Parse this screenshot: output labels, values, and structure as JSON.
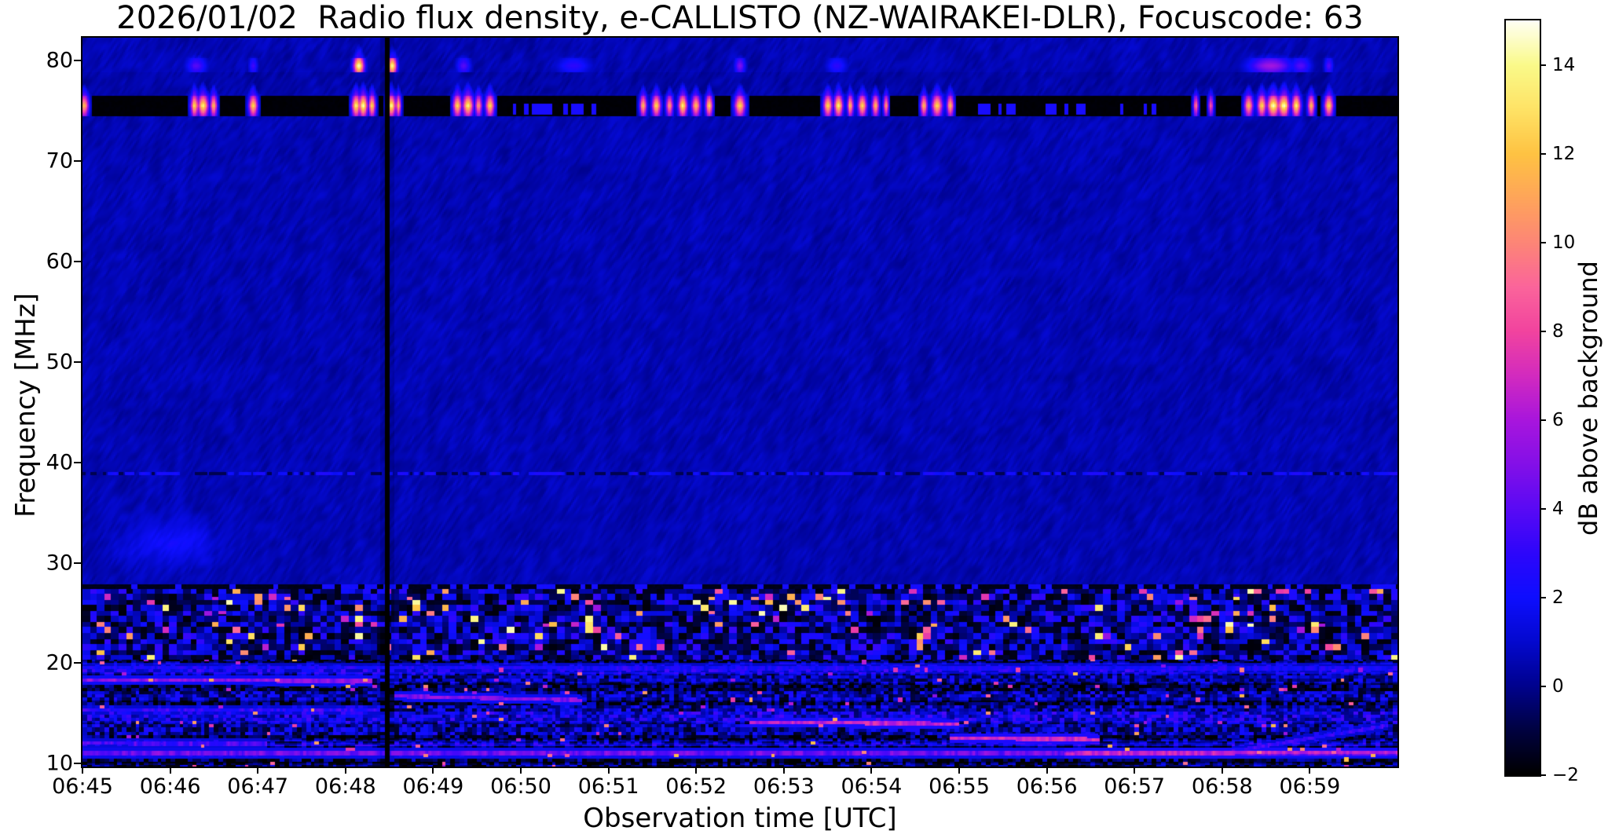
{
  "chart_data": {
    "type": "heatmap",
    "title": "2026/01/02  Radio flux density, e-CALLISTO (NZ-WAIRAKEI-DLR), Focuscode: 63",
    "xlabel": "Observation time [UTC]",
    "ylabel": "Frequency [MHz]",
    "colorbar_label": "dB above background",
    "x_axis": {
      "start_label": "06:45",
      "range_minutes": [
        0,
        15.0
      ],
      "ticks": [
        {
          "minute": 0,
          "label": "06:45"
        },
        {
          "minute": 1,
          "label": "06:46"
        },
        {
          "minute": 2,
          "label": "06:47"
        },
        {
          "minute": 3,
          "label": "06:48"
        },
        {
          "minute": 4,
          "label": "06:49"
        },
        {
          "minute": 5,
          "label": "06:50"
        },
        {
          "minute": 6,
          "label": "06:51"
        },
        {
          "minute": 7,
          "label": "06:52"
        },
        {
          "minute": 8,
          "label": "06:53"
        },
        {
          "minute": 9,
          "label": "06:54"
        },
        {
          "minute": 10,
          "label": "06:55"
        },
        {
          "minute": 11,
          "label": "06:56"
        },
        {
          "minute": 12,
          "label": "06:57"
        },
        {
          "minute": 13,
          "label": "06:58"
        },
        {
          "minute": 14,
          "label": "06:59"
        }
      ]
    },
    "y_axis": {
      "range_mhz": [
        9.7,
        82.3
      ],
      "ticks": [
        {
          "value": 80,
          "label": "80"
        },
        {
          "value": 70,
          "label": "70"
        },
        {
          "value": 60,
          "label": "60"
        },
        {
          "value": 50,
          "label": "50"
        },
        {
          "value": 40,
          "label": "40"
        },
        {
          "value": 30,
          "label": "30"
        },
        {
          "value": 20,
          "label": "20"
        },
        {
          "value": 10,
          "label": "10"
        }
      ]
    },
    "colorbar": {
      "range_db": [
        -2,
        15
      ],
      "ticks": [
        {
          "value": 14,
          "label": "14"
        },
        {
          "value": 12,
          "label": "12"
        },
        {
          "value": 10,
          "label": "10"
        },
        {
          "value": 8,
          "label": "8"
        },
        {
          "value": 6,
          "label": "6"
        },
        {
          "value": 4,
          "label": "4"
        },
        {
          "value": 2,
          "label": "2"
        },
        {
          "value": 0,
          "label": "0"
        },
        {
          "value": -2,
          "label": "−2"
        }
      ],
      "colormap_stops": [
        [
          -2,
          "#000000"
        ],
        [
          -1,
          "#000240"
        ],
        [
          0,
          "#00028e"
        ],
        [
          1,
          "#0409cf"
        ],
        [
          2,
          "#0e0eff"
        ],
        [
          3,
          "#2e06fb"
        ],
        [
          4,
          "#5a0af5"
        ],
        [
          5,
          "#8410e8"
        ],
        [
          6,
          "#a916dd"
        ],
        [
          7,
          "#d32bbf"
        ],
        [
          8,
          "#f2449f"
        ],
        [
          9,
          "#fb659b"
        ],
        [
          10,
          "#fd8677"
        ],
        [
          11,
          "#ffa55a"
        ],
        [
          12,
          "#fec343"
        ],
        [
          13,
          "#ffe366"
        ],
        [
          14,
          "#fafa8a"
        ],
        [
          15,
          "#fffff4"
        ]
      ]
    },
    "spectrogram": {
      "background_db": 0.55,
      "rfi_band_76": {
        "f_lo": 74.55,
        "f_hi": 76.6,
        "base_db": -1.9,
        "center_mhz": 75.55,
        "bursts_t_w_db": [
          [
            0.02,
            0.05,
            12
          ],
          [
            1.28,
            0.05,
            13
          ],
          [
            1.38,
            0.06,
            14
          ],
          [
            1.5,
            0.04,
            12
          ],
          [
            1.95,
            0.05,
            13
          ],
          [
            3.12,
            0.05,
            14
          ],
          [
            3.2,
            0.05,
            15
          ],
          [
            3.3,
            0.04,
            13
          ],
          [
            3.52,
            0.05,
            15
          ],
          [
            3.6,
            0.03,
            12
          ],
          [
            4.28,
            0.05,
            13
          ],
          [
            4.4,
            0.06,
            14
          ],
          [
            4.52,
            0.04,
            11
          ],
          [
            4.65,
            0.05,
            13
          ],
          [
            6.4,
            0.04,
            12
          ],
          [
            6.55,
            0.05,
            13
          ],
          [
            6.7,
            0.04,
            11
          ],
          [
            6.85,
            0.05,
            14
          ],
          [
            7.0,
            0.05,
            12
          ],
          [
            7.15,
            0.04,
            13
          ],
          [
            7.5,
            0.06,
            13
          ],
          [
            8.5,
            0.05,
            13
          ],
          [
            8.62,
            0.05,
            14
          ],
          [
            8.76,
            0.04,
            12
          ],
          [
            8.9,
            0.05,
            13
          ],
          [
            9.05,
            0.04,
            12
          ],
          [
            9.17,
            0.03,
            11
          ],
          [
            9.6,
            0.04,
            12
          ],
          [
            9.75,
            0.06,
            13
          ],
          [
            9.9,
            0.04,
            12
          ],
          [
            12.7,
            0.03,
            10
          ],
          [
            12.87,
            0.03,
            9
          ],
          [
            13.3,
            0.05,
            12
          ],
          [
            13.45,
            0.05,
            13
          ],
          [
            13.58,
            0.07,
            15
          ],
          [
            13.7,
            0.07,
            15
          ],
          [
            13.85,
            0.05,
            14
          ],
          [
            14.02,
            0.04,
            12
          ],
          [
            14.22,
            0.05,
            13
          ]
        ],
        "blue_dash_windows_min": [
          [
            4.9,
            5.85
          ],
          [
            10.15,
            10.65
          ],
          [
            10.95,
            11.45
          ],
          [
            11.75,
            11.95
          ],
          [
            12.1,
            12.25
          ]
        ],
        "blue_dash_db": 2.3
      },
      "rfi_band_79": {
        "f_lo": 78.8,
        "f_hi": 80.25,
        "center_mhz": 79.5,
        "bursts_t_w_db": [
          [
            1.3,
            0.12,
            4
          ],
          [
            1.95,
            0.05,
            3.5
          ],
          [
            3.15,
            0.06,
            15
          ],
          [
            3.53,
            0.05,
            15
          ],
          [
            4.35,
            0.08,
            4
          ],
          [
            5.6,
            0.2,
            3
          ],
          [
            7.5,
            0.06,
            5
          ],
          [
            8.6,
            0.12,
            3
          ],
          [
            13.55,
            0.25,
            6
          ],
          [
            13.9,
            0.12,
            4
          ],
          [
            14.22,
            0.05,
            4
          ]
        ]
      },
      "dashed_line_39": {
        "f_mhz": 38.85,
        "bright_db": 1.7,
        "dark_db": -0.8
      },
      "dashed_line_27": {
        "f_mhz": 27.55,
        "dark_db": -1.6,
        "dot_db": 2.2
      },
      "speckle_band": {
        "f_lo": 20.3,
        "f_hi": 27.75,
        "base_db_range": [
          -1.85,
          3.2
        ],
        "hotspot_db_range": [
          5.5,
          14.5
        ],
        "hot_rows_mhz": [
          23.1,
          25.7
        ]
      },
      "hf_noise_band": {
        "f_lo": 9.7,
        "f_hi": 20.3,
        "base_db_range": [
          -1.6,
          2.6
        ]
      },
      "hf_lines": [
        {
          "f0": 18.3,
          "f1": 18.2,
          "t0": 0,
          "t1": 3.3,
          "amp_db": 5.2
        },
        {
          "f0": 19.5,
          "f1": 19.45,
          "t0": 0,
          "t1": 15.0,
          "amp_db": 2.3
        },
        {
          "f0": 16.7,
          "f1": 16.3,
          "t0": 3.55,
          "t1": 5.7,
          "amp_db": 5.0
        },
        {
          "f0": 14.1,
          "f1": 13.95,
          "t0": 7.6,
          "t1": 10.0,
          "amp_db": 6.5
        },
        {
          "f0": 12.5,
          "f1": 12.4,
          "t0": 9.9,
          "t1": 11.6,
          "amp_db": 7.0
        },
        {
          "f0": 11.05,
          "f1": 11.0,
          "t0": 0,
          "t1": 15.0,
          "amp_db": 4.5
        },
        {
          "f0": 11.0,
          "f1": 11.1,
          "t0": 11.2,
          "t1": 15.0,
          "amp_db": 6.5
        },
        {
          "f0": 15.35,
          "f1": 15.3,
          "t0": 0,
          "t1": 3.4,
          "amp_db": 3.0
        },
        {
          "f0": 12.0,
          "f1": 11.95,
          "t0": 0,
          "t1": 2.1,
          "amp_db": 3.6
        },
        {
          "f0": 11.2,
          "f1": 13.8,
          "t0": 13.1,
          "t1": 14.9,
          "amp_db": 3.0
        }
      ],
      "data_gap_vertical": {
        "t_min": 3.47,
        "width_min": 0.05
      },
      "faint_blob": {
        "t_min": 1.0,
        "f_mhz": 32,
        "amp_db": 1.4
      }
    }
  }
}
